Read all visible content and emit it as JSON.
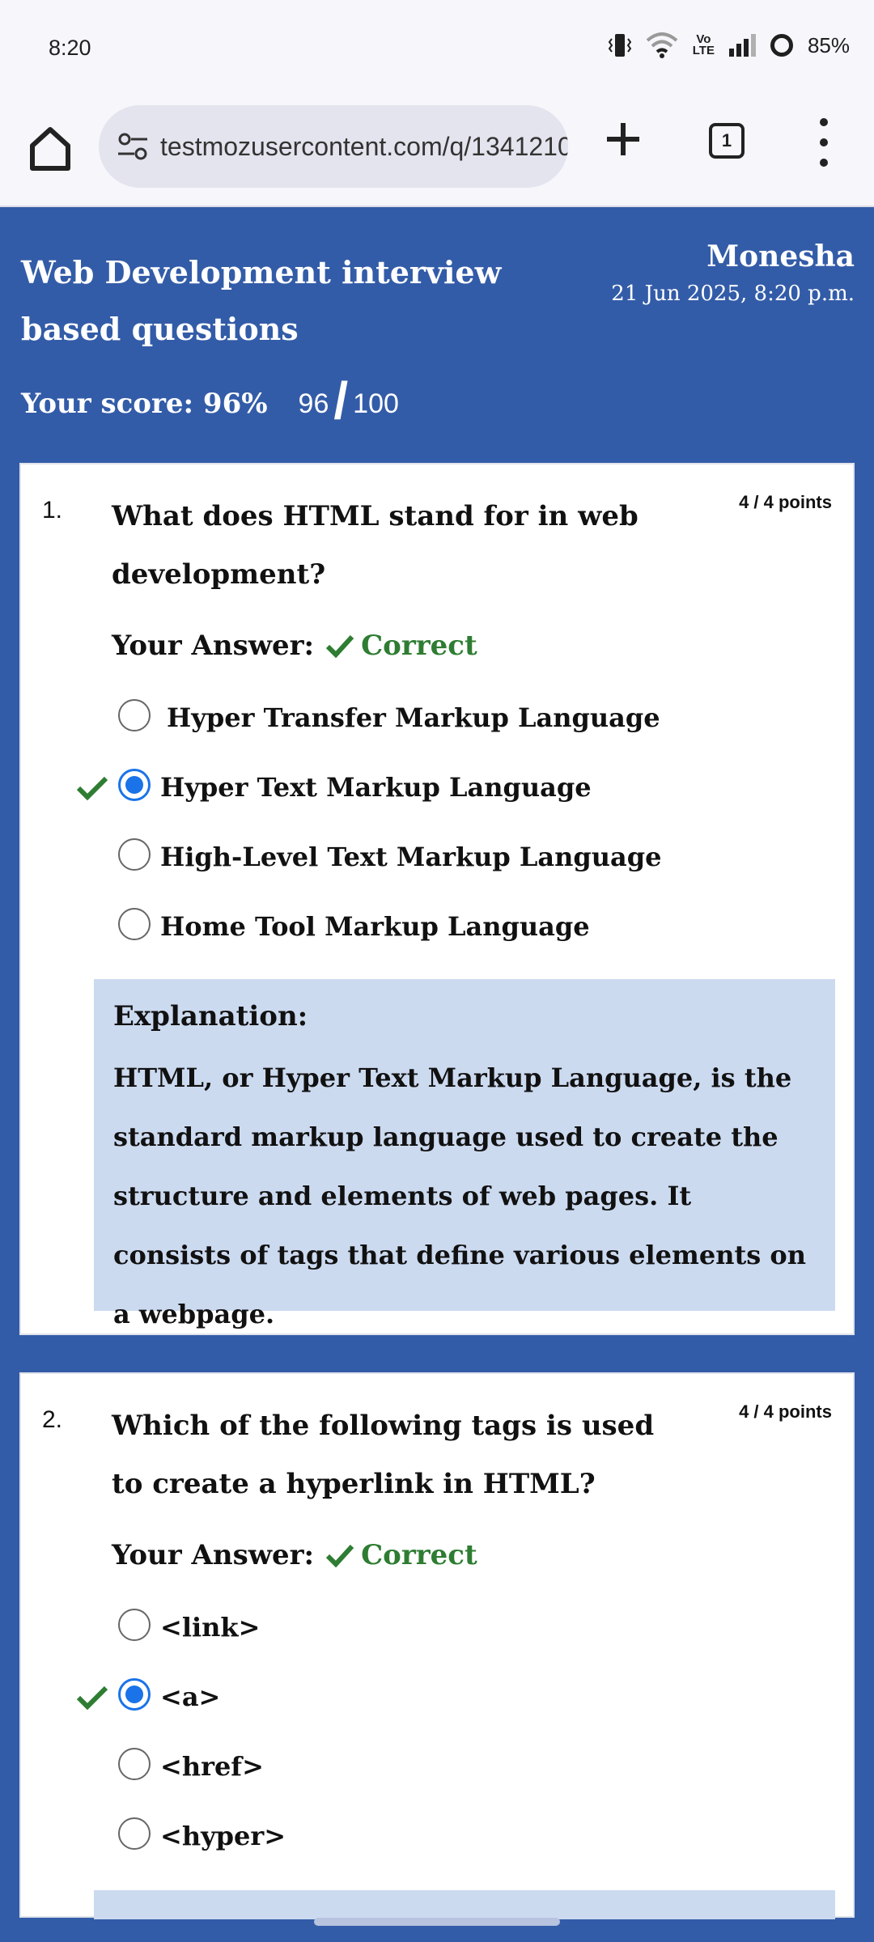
{
  "status_bar": {
    "time": "8:20",
    "network": "Vo\nLTE",
    "battery": "85%"
  },
  "browser": {
    "url": "testmozusercontent.com/q/1341210",
    "tab_count": "1"
  },
  "header": {
    "title": "Web Development interview based questions",
    "user_name": "Monesha",
    "submitted": "21 Jun 2025, 8:20 p.m.",
    "score_label": "Your score: 96%",
    "score_earned": "96",
    "score_total": "100"
  },
  "questions": [
    {
      "number": "1.",
      "text": "What does HTML stand for in web development?",
      "points": "4 / 4 points",
      "your_answer_label": "Your Answer:",
      "result": "Correct",
      "options": [
        {
          "label": "Hyper Transfer Markup Language",
          "selected": false,
          "correct": false
        },
        {
          "label": "Hyper Text Markup Language",
          "selected": true,
          "correct": true
        },
        {
          "label": "High-Level Text Markup Language",
          "selected": false,
          "correct": false
        },
        {
          "label": "Home Tool Markup Language",
          "selected": false,
          "correct": false
        }
      ],
      "explanation_title": "Explanation:",
      "explanation": "HTML, or Hyper Text Markup Language, is the standard markup language used to create the structure and elements of web pages. It consists of tags that define various elements on a webpage."
    },
    {
      "number": "2.",
      "text": "Which of the following tags is used to create a hyperlink in HTML?",
      "points": "4 / 4 points",
      "your_answer_label": "Your Answer:",
      "result": "Correct",
      "options": [
        {
          "label": "<link>",
          "selected": false,
          "correct": false
        },
        {
          "label": "<a>",
          "selected": true,
          "correct": true
        },
        {
          "label": "<href>",
          "selected": false,
          "correct": false
        },
        {
          "label": "<hyper>",
          "selected": false,
          "correct": false
        }
      ]
    }
  ],
  "colors": {
    "page_background": "#335ca8",
    "correct_green": "#2e7d32",
    "radio_blue": "#1a73e8",
    "explanation_bg": "#ccdaf0"
  }
}
